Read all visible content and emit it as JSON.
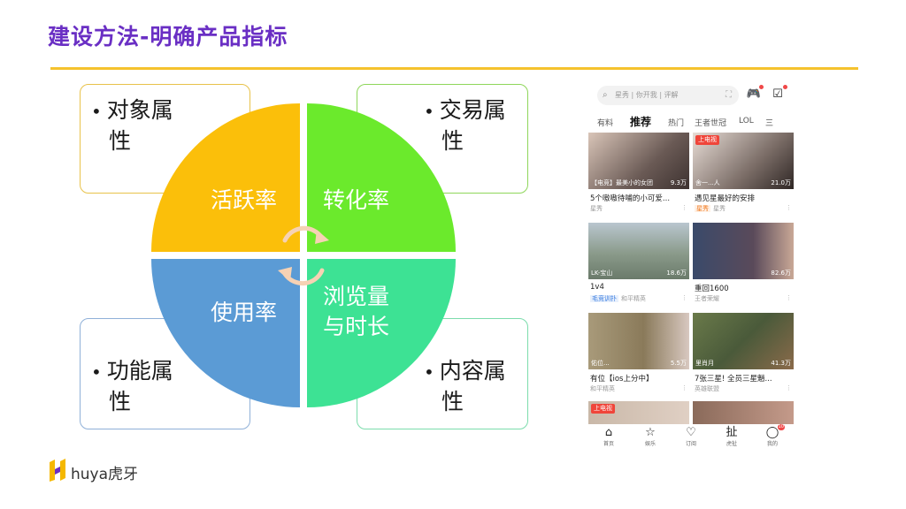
{
  "slide": {
    "title": "建设方法-明确产品指标"
  },
  "boxes": {
    "top_left": {
      "line1": "对象属",
      "line2": "性"
    },
    "top_right": {
      "line1": "交易属",
      "line2": "性"
    },
    "bottom_left": {
      "line1": "功能属",
      "line2": "性"
    },
    "bottom_right": {
      "line1": "内容属",
      "line2": "性"
    }
  },
  "quadrants": {
    "top_left": {
      "label": "活跃率",
      "color": "#fbbf0a"
    },
    "top_right": {
      "label": "转化率",
      "color": "#6bea2c"
    },
    "bottom_left": {
      "label": "使用率",
      "color": "#5b9bd5"
    },
    "bottom_right": {
      "line1": "浏览量",
      "line2": "与时长",
      "color": "#3de294"
    }
  },
  "phone": {
    "search_placeholder": "星秀 | 你开我 | 评解",
    "tabs": [
      "有料",
      "推荐",
      "热门",
      "王者世冠",
      "LOL",
      "三"
    ],
    "cards": [
      {
        "overlay_left": "【电竞】最美小的女团",
        "overlay_right": "9.3万",
        "title": "5个嗷嗷待哺的小可爱...",
        "sub": "星秀",
        "badge": ""
      },
      {
        "overlay_left": "舍一...人",
        "overlay_right": "21.0万",
        "title": "遇见星最好的安排",
        "tag": "星秀",
        "sub": "星秀",
        "badge": "上电视"
      },
      {
        "overlay_left": "LK-宝山",
        "overlay_right": "18.6万",
        "title": "1v4",
        "tag": "毛竞训扑",
        "sub": "和平精英",
        "badge": ""
      },
      {
        "overlay_left": "",
        "overlay_right": "82.6万",
        "title": "重回1600",
        "sub": "王者荣耀",
        "badge": ""
      },
      {
        "overlay_left": "佑位...",
        "overlay_right": "5.5万",
        "title": "有位【ios上分中】",
        "sub": "和平精英",
        "badge": ""
      },
      {
        "overlay_left": "里肖月",
        "overlay_right": "41.3万",
        "title": "7张三星! 全员三星魈...",
        "sub": "英雄联盟",
        "badge": ""
      },
      {
        "overlay_left": "",
        "overlay_right": "",
        "title": "",
        "sub": "",
        "badge": "上电视"
      },
      {
        "overlay_left": "",
        "overlay_right": "",
        "title": "",
        "sub": "",
        "badge": ""
      }
    ],
    "nav": [
      {
        "icon": "home-icon",
        "label": "首页"
      },
      {
        "icon": "star-icon",
        "label": "娱乐"
      },
      {
        "icon": "heart-icon",
        "label": "订阅"
      },
      {
        "icon": "fire-icon",
        "label": "虎扯"
      },
      {
        "icon": "chat-icon",
        "label": "我的",
        "count": "10"
      }
    ]
  },
  "footer": {
    "brand": "huya虎牙"
  }
}
